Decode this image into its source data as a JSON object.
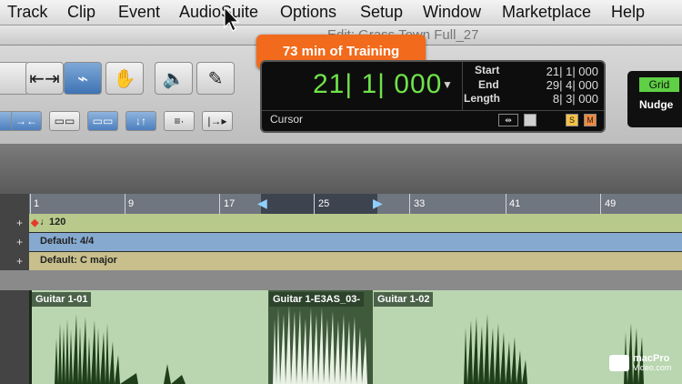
{
  "menu": [
    "Track",
    "Clip",
    "Event",
    "AudioSuite",
    "Options",
    "Setup",
    "Window",
    "Marketplace",
    "Help"
  ],
  "window_title": "Edit: Grass Town Full_27",
  "badge_text": "73 min of Training",
  "counter": {
    "main": "21| 1| 000",
    "cursor_label": "Cursor",
    "start_label": "Start",
    "start_value": "21| 1| 000",
    "end_label": "End",
    "end_value": "29| 4| 000",
    "length_label": "Length",
    "length_value": "8| 3| 000",
    "icon_s": "S",
    "icon_m": "M"
  },
  "grid_panel": {
    "grid_label": "Grid",
    "nudge_label": "Nudge"
  },
  "ruler_numbers": [
    "1",
    "9",
    "17",
    "25",
    "33",
    "41",
    "49"
  ],
  "rulers": {
    "tempo": "120",
    "meter": "Default: 4/4",
    "key": "Default: C major"
  },
  "clips": [
    "Guitar 1-01",
    "Guitar 1-E3AS_03-",
    "Guitar 1-02"
  ],
  "watermark": {
    "line1": "macPro",
    "line2": "Video.com"
  },
  "colors": {
    "badge": "#f26a1b",
    "counter_text": "#6fe34a",
    "tempo_row": "#b8c98c",
    "meter_row": "#86a9cf",
    "key_row": "#c8bf8c",
    "clip_bg": "#b9d6b0",
    "waveform": "#1f3f1a"
  }
}
